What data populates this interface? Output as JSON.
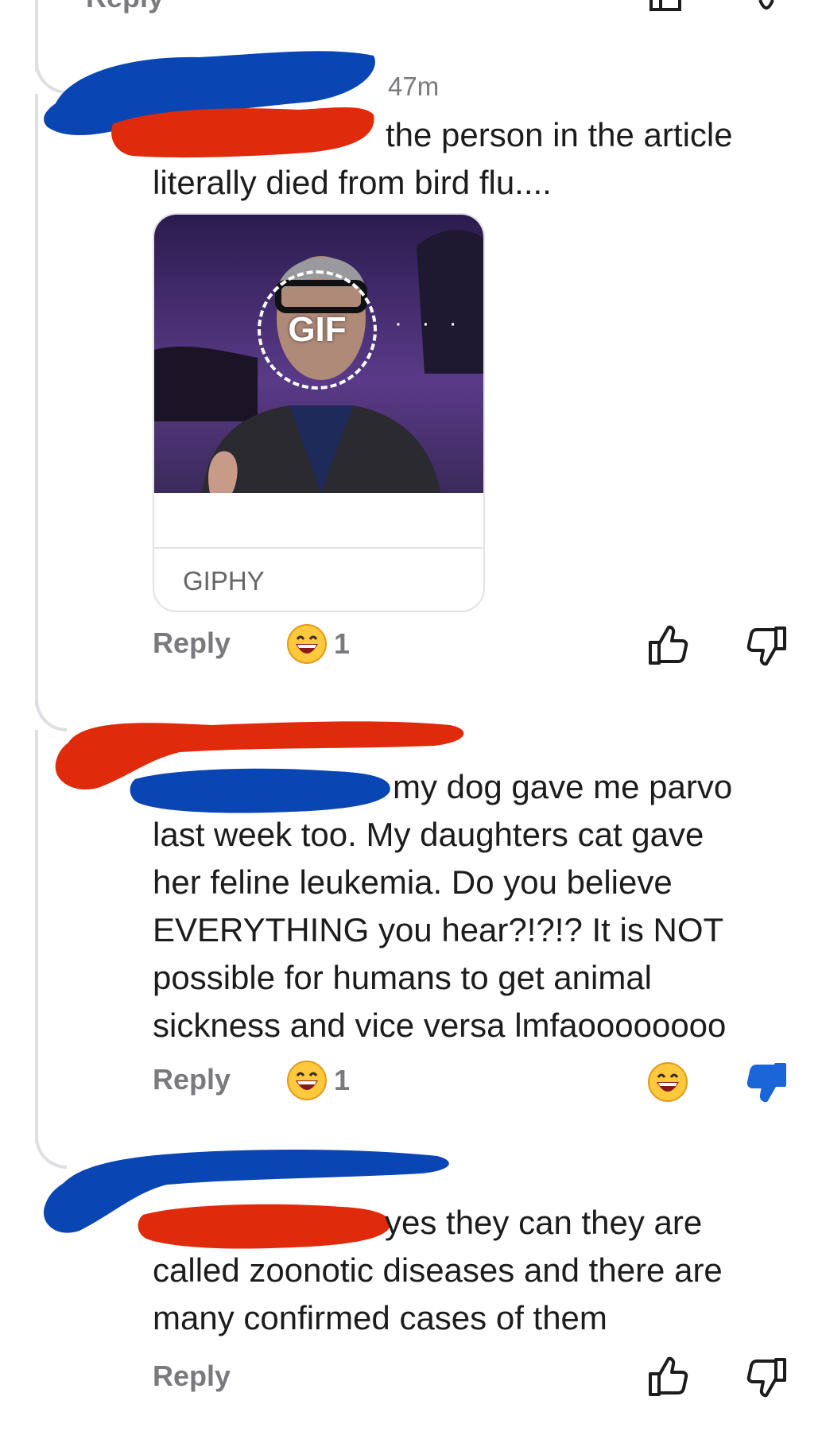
{
  "colors": {
    "redact_blue": "#0a45b4",
    "redact_red": "#e02a0c",
    "accent_blue": "#1a66d9",
    "thread_line": "#dedfe3"
  },
  "top_partial": {
    "reply_label": "Reply"
  },
  "comments": [
    {
      "timestamp": "47m",
      "lines": [
        "the person in the article",
        "literally died from bird flu...."
      ],
      "gif": {
        "label": "GIF",
        "source": "GIPHY"
      },
      "reply_label": "Reply",
      "reaction": {
        "icon": "grinning-emoji-icon",
        "count": "1"
      },
      "actions": {
        "upvote": "thumbs-up-icon",
        "downvote": "thumbs-down-icon",
        "downvote_active": false
      }
    },
    {
      "lines": [
        "my dog gave me parvo",
        "last week too. My daughters cat gave",
        "her feline leukemia. Do you believe",
        "EVERYTHING you hear?!?!? It is NOT",
        "possible for humans to get animal",
        "sickness and vice versa lmfaoooooooo"
      ],
      "reply_label": "Reply",
      "reaction": {
        "icon": "grinning-emoji-icon",
        "count": "1"
      },
      "actions": {
        "user_reaction": "grinning-emoji-icon",
        "downvote": "thumbs-down-icon",
        "downvote_active": true
      }
    },
    {
      "lines": [
        "yes they can they are",
        "called zoonotic diseases and there are",
        "many confirmed cases of them"
      ],
      "reply_label": "Reply",
      "actions": {
        "upvote": "thumbs-up-icon",
        "downvote": "thumbs-down-icon",
        "downvote_active": false
      }
    }
  ]
}
